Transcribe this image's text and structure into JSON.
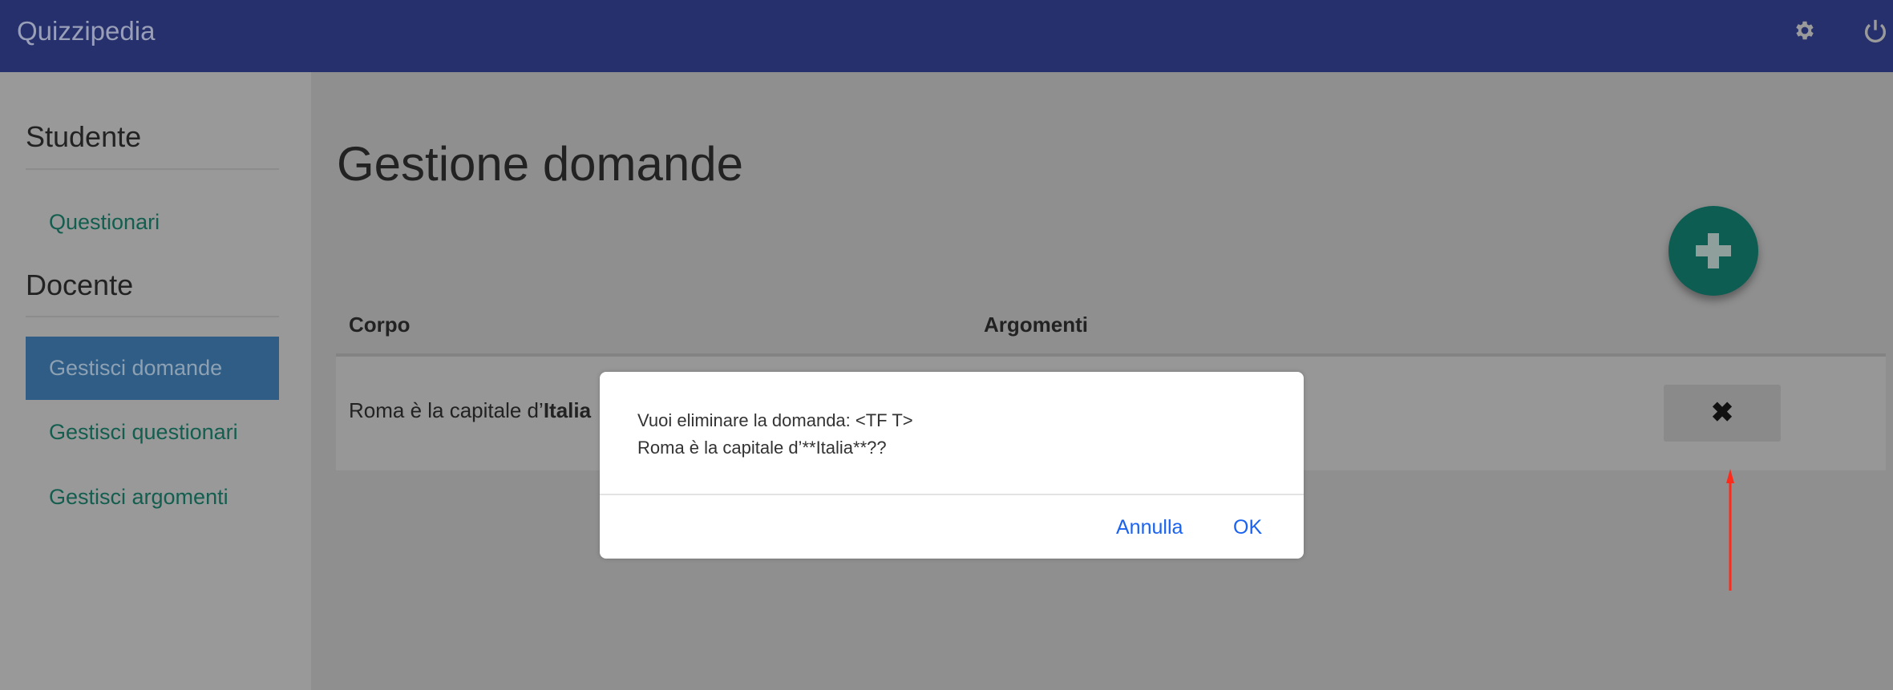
{
  "header": {
    "brand": "Quizzipedia",
    "icons": [
      "gear-icon",
      "power-icon"
    ]
  },
  "sidebar": {
    "sections": [
      {
        "title": "Studente"
      },
      {
        "title": "Docente"
      }
    ],
    "items": [
      {
        "label": "Questionari",
        "active": false
      },
      {
        "label": "Gestisci domande",
        "active": true
      },
      {
        "label": "Gestisci questionari",
        "active": false
      },
      {
        "label": "Gestisci argomenti",
        "active": false
      }
    ]
  },
  "main": {
    "title": "Gestione domande",
    "table": {
      "headers": [
        "Corpo",
        "Argomenti"
      ],
      "rows": [
        {
          "corpo_prefix": "Roma è la capitale d’",
          "corpo_bold": "Italia",
          "argomenti": ""
        }
      ]
    },
    "delete_icon": "✖"
  },
  "dialog": {
    "line1": "Vuoi eliminare la domanda: <TF T>",
    "line2": "Roma è la capitale d’**Italia**??",
    "cancel": "Annulla",
    "ok": "OK"
  },
  "colors": {
    "header": "#25306c",
    "accent": "#135e4f",
    "link": "#1a62f0",
    "annotation_arrow": "#ff2a1a"
  }
}
